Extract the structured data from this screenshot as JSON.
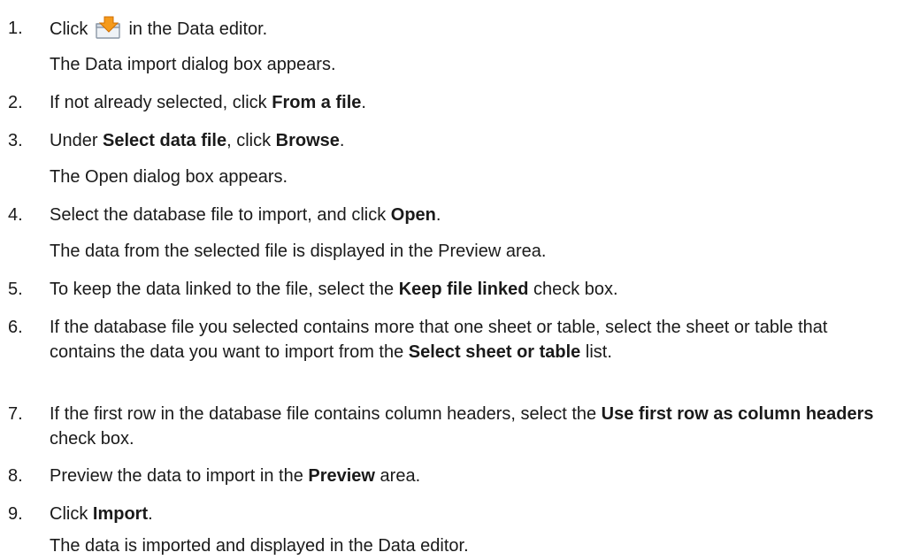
{
  "steps": [
    {
      "number": "1.",
      "parts": [
        "Click",
        "in the Data editor."
      ],
      "icon": "import-data-icon",
      "result": "The Data import dialog box appears."
    },
    {
      "number": "2.",
      "parts": [
        "If not already selected, click ",
        "From a file",
        "."
      ]
    },
    {
      "number": "3.",
      "parts": [
        "Under ",
        "Select data file",
        ", click ",
        "Browse",
        "."
      ],
      "result": "The Open dialog box appears."
    },
    {
      "number": "4.",
      "parts": [
        "Select the database file to import, and click ",
        "Open",
        "."
      ],
      "result": "The data from the selected file is displayed in the Preview area."
    },
    {
      "number": "5.",
      "parts": [
        "To keep the data linked to the file, select the ",
        "Keep file linked",
        " check box."
      ]
    },
    {
      "number": "6.",
      "parts": [
        "If the database file you selected contains more that one sheet or table, select the sheet or table that contains the data you want to import from the ",
        "Select sheet or table",
        " list."
      ]
    },
    {
      "number": "7.",
      "parts": [
        "If the first row in the database file contains column headers, select the ",
        "Use first row as column headers",
        " check box."
      ]
    },
    {
      "number": "8.",
      "parts": [
        "Preview the data to import in the ",
        "Preview",
        " area."
      ]
    },
    {
      "number": "9.",
      "parts": [
        "Click ",
        "Import",
        "."
      ],
      "result": "The data is imported and displayed in the Data editor."
    }
  ]
}
